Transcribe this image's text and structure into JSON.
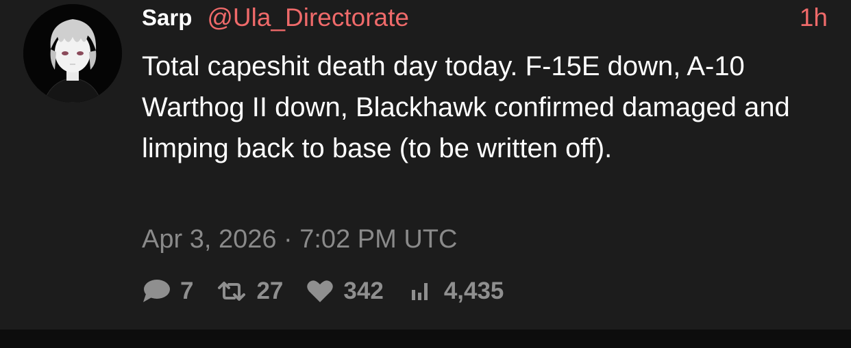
{
  "author": {
    "display_name": "Sarp",
    "handle": "@Ula_Directorate",
    "avatar_icon": "anime-avatar"
  },
  "time_ago": "1h",
  "text": "Total capeshit death day today. F-15E down, A-10 Warthog II down, Blackhawk confirmed damaged and limping back to base (to be written off).",
  "timestamp": "Apr 3, 2026 · 7:02 PM UTC",
  "stats": {
    "replies": "7",
    "retweets": "27",
    "likes": "342",
    "views": "4,435"
  },
  "colors": {
    "background": "#1c1c1c",
    "accent": "#ef6a6a",
    "text": "#ffffff",
    "muted": "#8a8a8a"
  }
}
